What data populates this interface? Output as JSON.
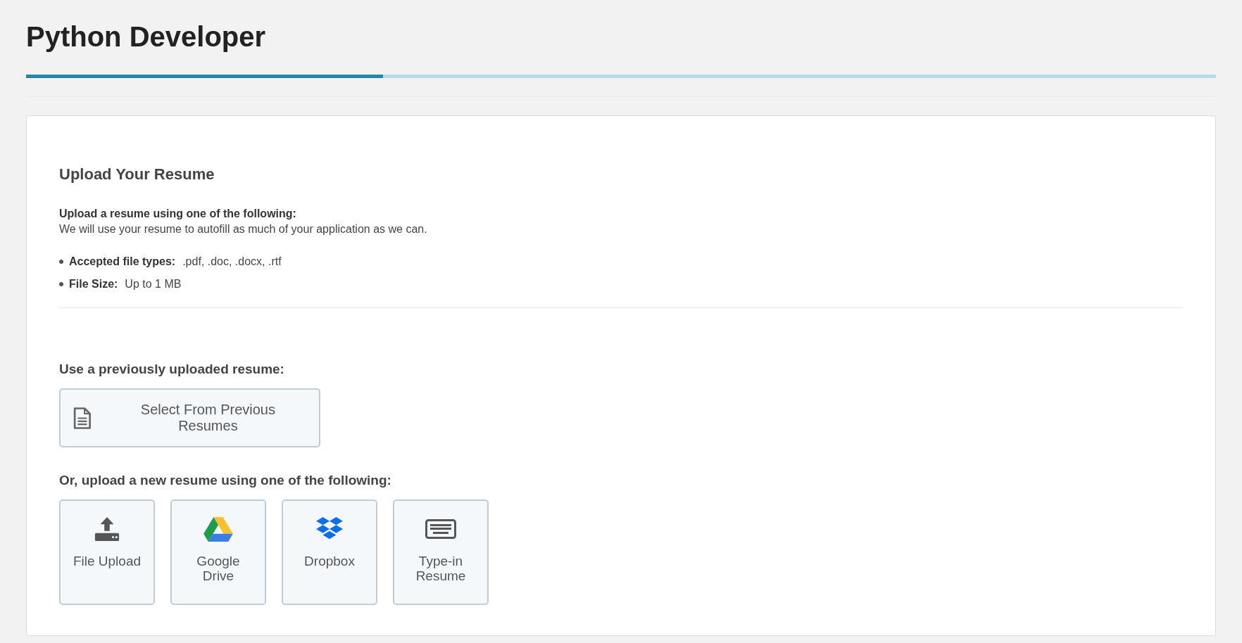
{
  "page": {
    "title": "Python Developer"
  },
  "progress": {
    "level": 0.3
  },
  "section": {
    "heading": "Upload Your Resume",
    "intro_title": "Upload a resume using one of the following:",
    "intro_text": "We will use your resume to autofill as much of your application as we can.",
    "requirements": [
      {
        "label": "Accepted file types:",
        "value": ".pdf, .doc, .docx, .rtf"
      },
      {
        "label": "File Size:",
        "value": "Up to 1 MB"
      }
    ]
  },
  "previous": {
    "label": "Use a previously uploaded resume:",
    "button": "Select From Previous Resumes"
  },
  "upload": {
    "label": "Or, upload a new resume using one of the following:",
    "sources": [
      {
        "kind": "upload",
        "label": "File Upload"
      },
      {
        "kind": "drive",
        "label": "Google Drive"
      },
      {
        "kind": "dropbox",
        "label": "Dropbox"
      },
      {
        "kind": "keyboard",
        "label": "Type-in Resume"
      }
    ]
  }
}
